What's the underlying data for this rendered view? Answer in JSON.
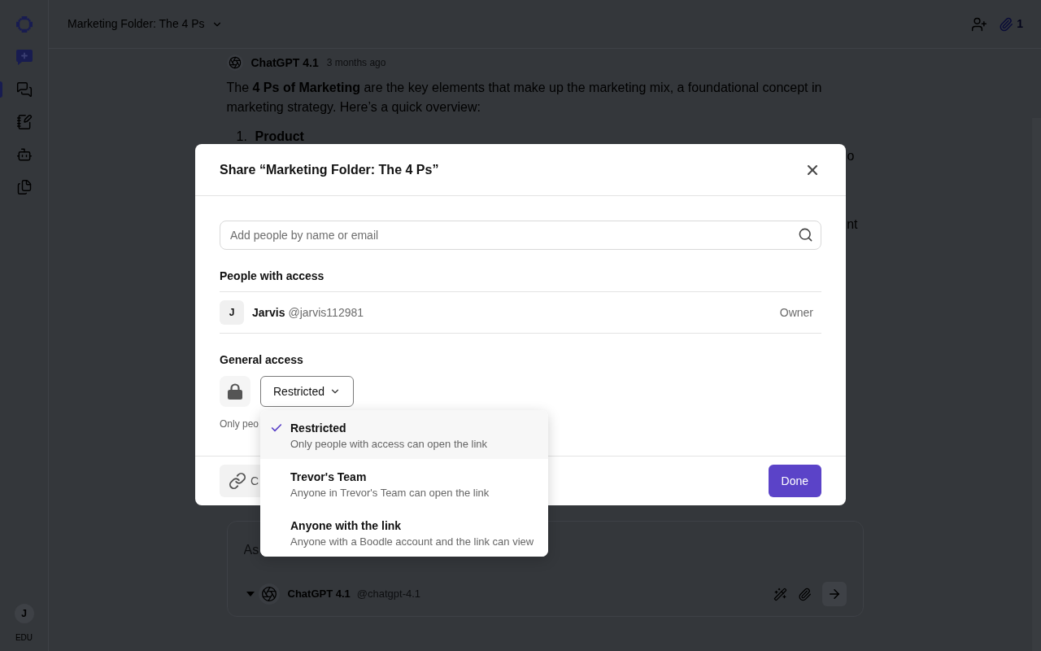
{
  "sidebar": {
    "items": [
      {
        "kind": "new-chat",
        "selected": false
      },
      {
        "kind": "chats",
        "selected": true
      },
      {
        "kind": "notebook",
        "selected": false
      },
      {
        "kind": "bots",
        "selected": false
      },
      {
        "kind": "files",
        "selected": false
      }
    ],
    "user": {
      "initial": "J",
      "plan": "EDU"
    }
  },
  "header": {
    "title": "Marketing Folder: The 4 Ps",
    "attachments": "1"
  },
  "message": {
    "author": "ChatGPT 4.1",
    "time": "3 months ago",
    "text": "The **4 Ps of Marketing** are the key elements that make up the marketing mix, a foundational concept in marketing strategy. Here’s a quick overview:",
    "list": [
      {
        "number": "1.",
        "title": "Product"
      }
    ],
    "fragments": [
      "o",
      "nt"
    ]
  },
  "composer": {
    "placeholder": "As",
    "model": "ChatGPT 4.1",
    "handle": "@chatgpt-4.1"
  },
  "dialog": {
    "title": "Share “Marketing Folder: The 4 Ps”",
    "search": {
      "placeholder": "Add people by name or email"
    },
    "people_heading": "People with access",
    "people": [
      {
        "initial": "J",
        "name": "Jarvis",
        "handle": "@jarvis112981",
        "role": "Owner"
      }
    ],
    "access_heading": "General access",
    "access_select": {
      "value": "Restricted",
      "expanded": true
    },
    "access_note": "Only peo",
    "copy_button": "C",
    "done_button": "Done",
    "access_options": [
      {
        "title": "Restricted",
        "description": "Only people with access can open the link",
        "selected": true
      },
      {
        "title": "Trevor's Team",
        "description": "Anyone in Trevor's Team can open the link",
        "selected": false
      },
      {
        "title": "Anyone with the link",
        "description": "Anyone with a Boodle account and the link can view",
        "selected": false
      }
    ]
  }
}
